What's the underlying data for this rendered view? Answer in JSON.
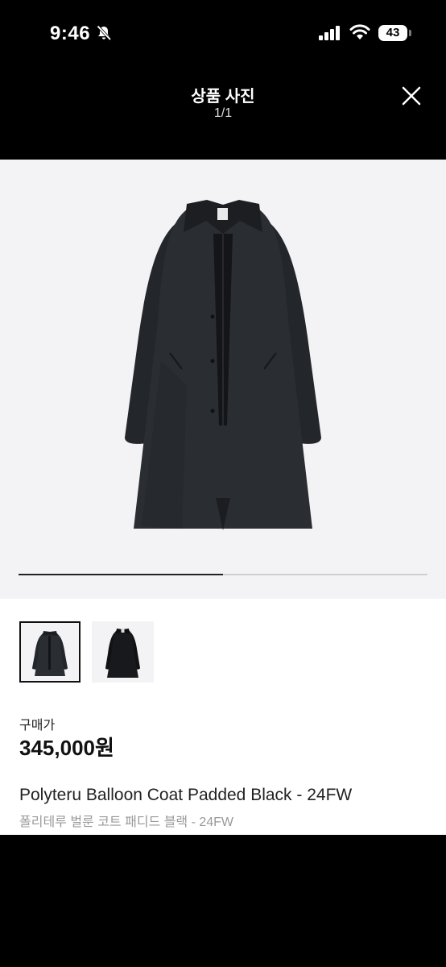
{
  "status": {
    "time": "9:46",
    "battery": "43"
  },
  "header": {
    "title": "상품 사진",
    "counter": "1/1"
  },
  "gallery": {
    "progress": 0.5
  },
  "product": {
    "price_label": "구매가",
    "price": "345,000원",
    "name_en": "Polyteru Balloon Coat Padded Black - 24FW",
    "name_ko": "폴리테루 벌룬 코트 패디드 블랙 - 24FW"
  },
  "colors": {
    "background": "#000000",
    "panel": "#ffffff",
    "photo_bg": "#f3f3f5"
  }
}
